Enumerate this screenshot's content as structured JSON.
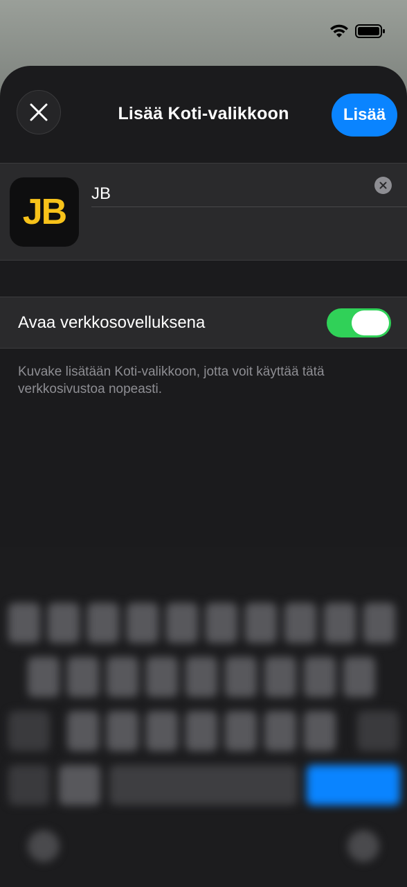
{
  "status_bar": {
    "wifi_icon": "wifi-icon",
    "battery_icon": "battery-icon"
  },
  "header": {
    "title": "Lisää Koti-valikkoon",
    "add_label": "Lisää",
    "close_icon": "close-icon"
  },
  "bookmark": {
    "icon_text": "JB",
    "name_value": "JB",
    "clear_icon": "clear-icon"
  },
  "toggle_row": {
    "label": "Avaa verkkosovelluksena",
    "enabled": true
  },
  "footnote": "Kuvake lisätään Koti-valikkoon, jotta voit käyttää tätä verkkosivustoa nopeasti.",
  "colors": {
    "accent": "#0a84ff",
    "toggle_on": "#30d158",
    "icon_text": "#f7c21a",
    "sheet_bg": "#1b1b1d"
  }
}
